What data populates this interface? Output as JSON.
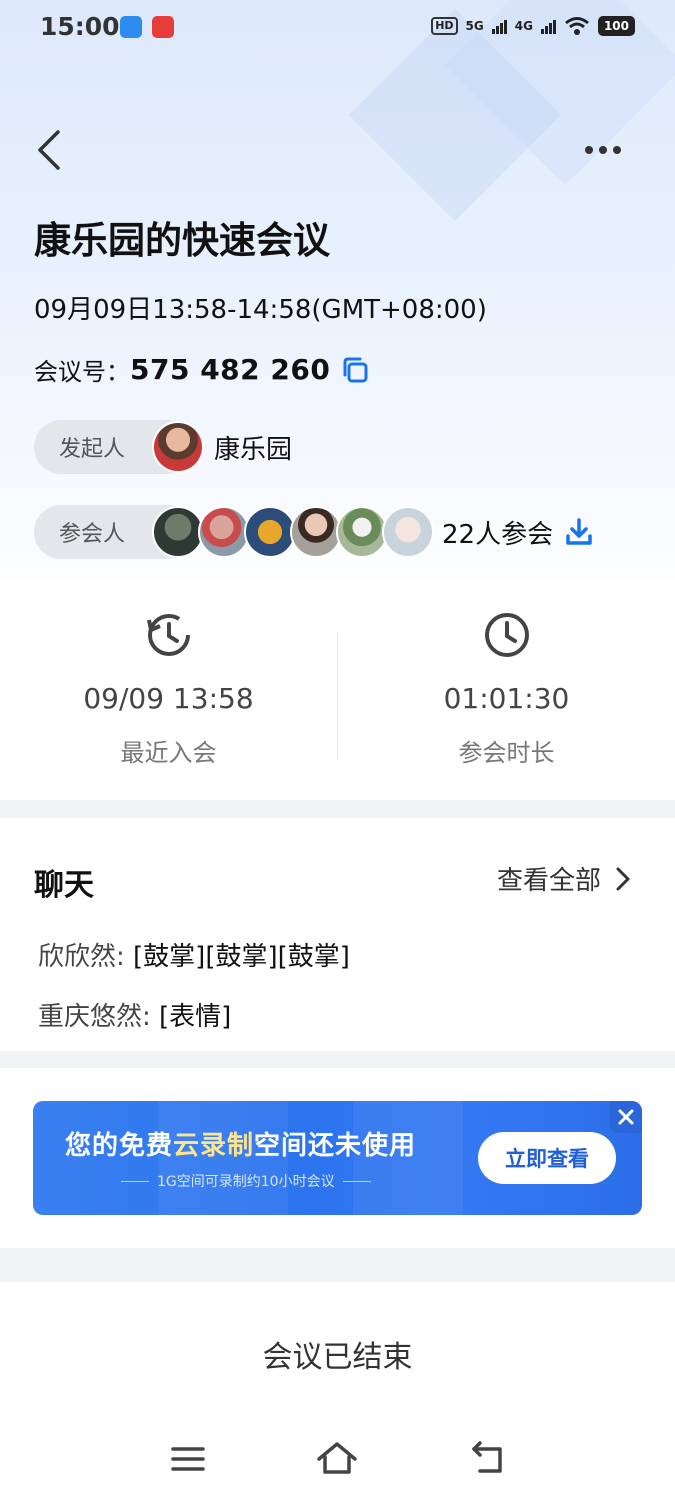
{
  "status_bar": {
    "time": "15:00",
    "network": "5G",
    "network2": "4G",
    "hd": "HD",
    "battery": "100"
  },
  "meeting": {
    "title": "康乐园的快速会议",
    "time_range": "09月09日13:58-14:58(GMT+08:00)",
    "id_label": "会议号：",
    "id": "575 482 260",
    "host_label": "发起人",
    "host_name": "康乐园",
    "participants_label": "参会人",
    "participants_count": "22人参会"
  },
  "stats": [
    {
      "value": "09/09 13:58",
      "label": "最近入会",
      "icon": "history-clock-icon"
    },
    {
      "value": "01:01:30",
      "label": "参会时长",
      "icon": "clock-icon"
    }
  ],
  "chat": {
    "title": "聊天",
    "view_all": "查看全部",
    "messages": [
      {
        "sender": "欣欣然:",
        "text": "[鼓掌][鼓掌][鼓掌]"
      },
      {
        "sender": "重庆悠然:",
        "text": "[表情]"
      }
    ]
  },
  "banner": {
    "text_a": "您的免费",
    "text_highlight": "云录制",
    "text_b": "空间还未使用",
    "sub": "1G空间可录制约10小时会议",
    "button": "立即查看"
  },
  "footer": {
    "status": "会议已结束"
  },
  "colors": {
    "accent": "#1a73e8",
    "banner_highlight": "#ffe58a"
  }
}
